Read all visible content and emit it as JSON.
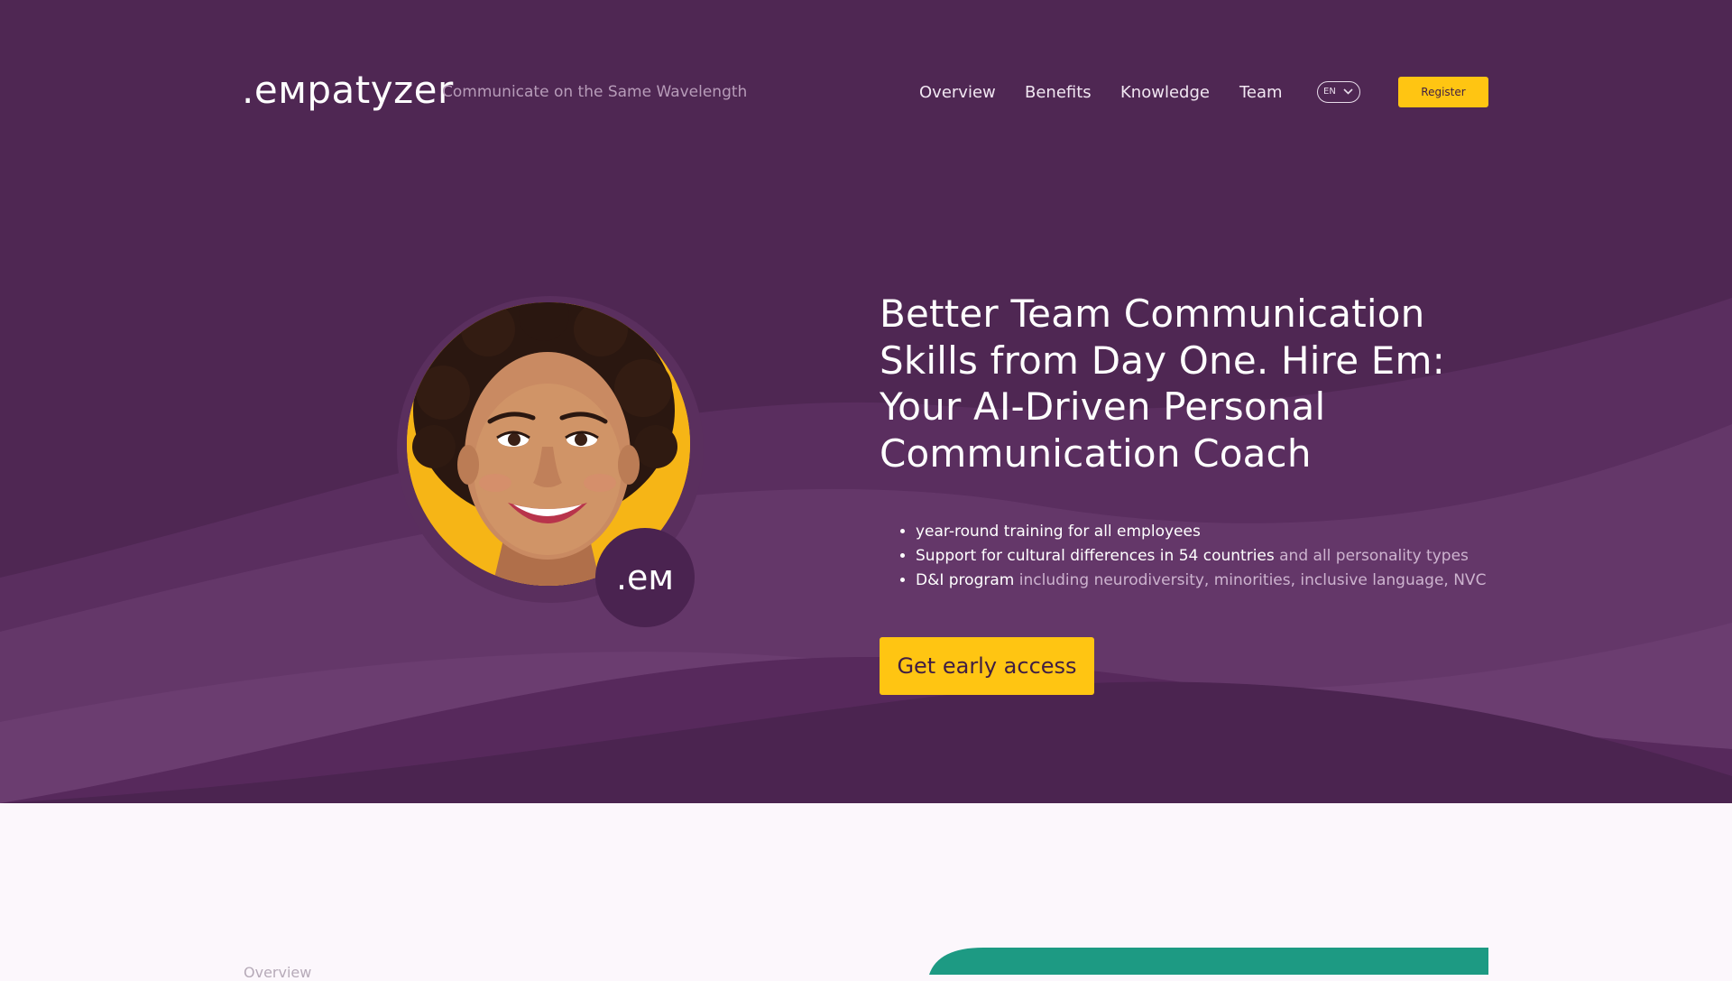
{
  "brand": {
    "logo": ".eмpatyzer",
    "tagline": "Communicate on the Same Wavelength"
  },
  "nav": {
    "items": [
      {
        "label": "Overview"
      },
      {
        "label": "Benefits"
      },
      {
        "label": "Knowledge"
      },
      {
        "label": "Team"
      }
    ],
    "language": "EN",
    "register_label": "Register"
  },
  "hero": {
    "headline": "Better Team Communication Skills from Day One. Hire Em: Your AI-Driven Personal Communication Coach",
    "bullets": [
      {
        "strong": "year-round training for all employees",
        "light": ""
      },
      {
        "strong": "Support for cultural differences in 54 countries",
        "light": " and all personality types"
      },
      {
        "strong": "D&I program",
        "light": " including neurodiversity, minorities, inclusive language, NVC"
      }
    ],
    "avatar_badge": ".eм",
    "cta_label": "Get early access"
  },
  "next_section": {
    "label": "Overview"
  },
  "colors": {
    "hero_bg": "#4f2753",
    "accent": "#ffc512",
    "teal": "#1d9a83",
    "page_bg": "#fcf7fc"
  },
  "icons": {
    "language_dropdown": "chevron-down-icon"
  }
}
